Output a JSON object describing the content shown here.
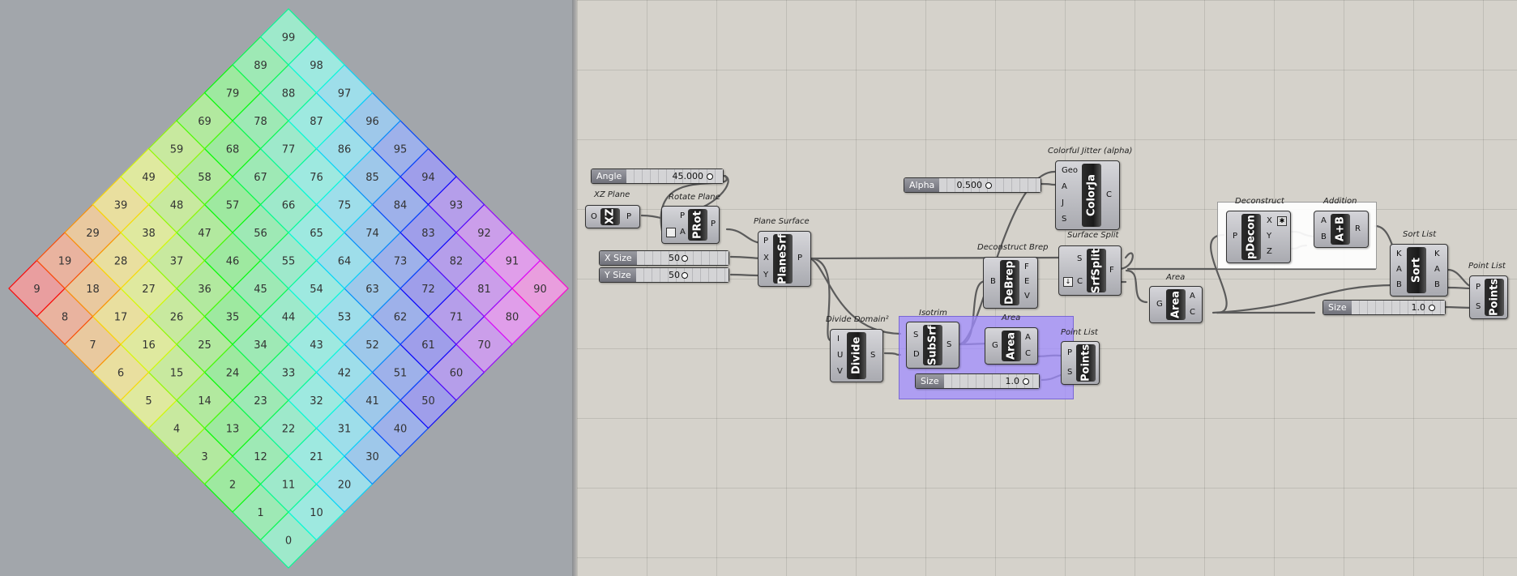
{
  "viewport": {
    "grid_rows": 10,
    "grid_cols": 10,
    "cells_description": "number = col*10 + row",
    "color_left": "#f08080",
    "color_top": "#e060d0"
  },
  "canvas": {
    "sliders": {
      "angle": {
        "name": "Angle",
        "value": "45.000"
      },
      "alpha": {
        "name": "Alpha",
        "value": "0.500"
      },
      "xsize": {
        "name": "X Size",
        "value": "50"
      },
      "ysize": {
        "name": "Y Size",
        "value": "50"
      },
      "size1": {
        "name": "Size",
        "value": "1.0"
      },
      "size2": {
        "name": "Size",
        "value": "1.0"
      }
    },
    "components": {
      "xz": {
        "label": "XZ Plane",
        "core": "XZ",
        "in": [
          "O"
        ],
        "out": [
          "P"
        ]
      },
      "prot": {
        "label": "Rotate Plane",
        "core": "PRot",
        "in": [
          "P",
          "A"
        ],
        "out": [
          "P"
        ]
      },
      "planesrf": {
        "label": "Plane Surface",
        "core": "PlaneSrf",
        "in": [
          "P",
          "X",
          "Y"
        ],
        "out": [
          "P"
        ]
      },
      "divide": {
        "label": "Divide Domain²",
        "core": "Divide",
        "in": [
          "I",
          "U",
          "V"
        ],
        "out": [
          "S"
        ]
      },
      "subsrf": {
        "label": "Isotrim",
        "core": "SubSrf",
        "in": [
          "S",
          "D"
        ],
        "out": [
          "S"
        ]
      },
      "area1": {
        "label": "Area",
        "core": "Area",
        "in": [
          "G"
        ],
        "out": [
          "A",
          "C"
        ]
      },
      "points1": {
        "label": "Point List",
        "core": "Points",
        "in": [
          "P",
          "S"
        ],
        "out": []
      },
      "colorja": {
        "label": "Colorful Jitter (alpha)",
        "core": "ColorJa",
        "in": [
          "Geo",
          "A",
          "J",
          "S"
        ],
        "out": [
          "C"
        ]
      },
      "debrep": {
        "label": "Deconstruct Brep",
        "core": "DeBrep",
        "in": [
          "B"
        ],
        "out": [
          "F",
          "E",
          "V"
        ]
      },
      "srfsplit": {
        "label": "Surface Split",
        "core": "SrfSplit",
        "in": [
          "S",
          "C"
        ],
        "out": [
          "F"
        ]
      },
      "area2": {
        "label": "Area",
        "core": "Area",
        "in": [
          "G"
        ],
        "out": [
          "A",
          "C"
        ]
      },
      "pdecon": {
        "label": "Deconstruct",
        "core": "pDecon",
        "in": [
          "P"
        ],
        "out": [
          "X",
          "Y",
          "Z"
        ]
      },
      "addition": {
        "label": "Addition",
        "core": "A+B",
        "in": [
          "A",
          "B"
        ],
        "out": [
          "R"
        ]
      },
      "sort": {
        "label": "Sort List",
        "core": "Sort",
        "in": [
          "K",
          "A",
          "B"
        ],
        "out": [
          "K",
          "A",
          "B"
        ]
      },
      "points2": {
        "label": "Point List",
        "core": "Points",
        "in": [
          "P",
          "S"
        ],
        "out": []
      }
    },
    "group_label": "Area"
  }
}
